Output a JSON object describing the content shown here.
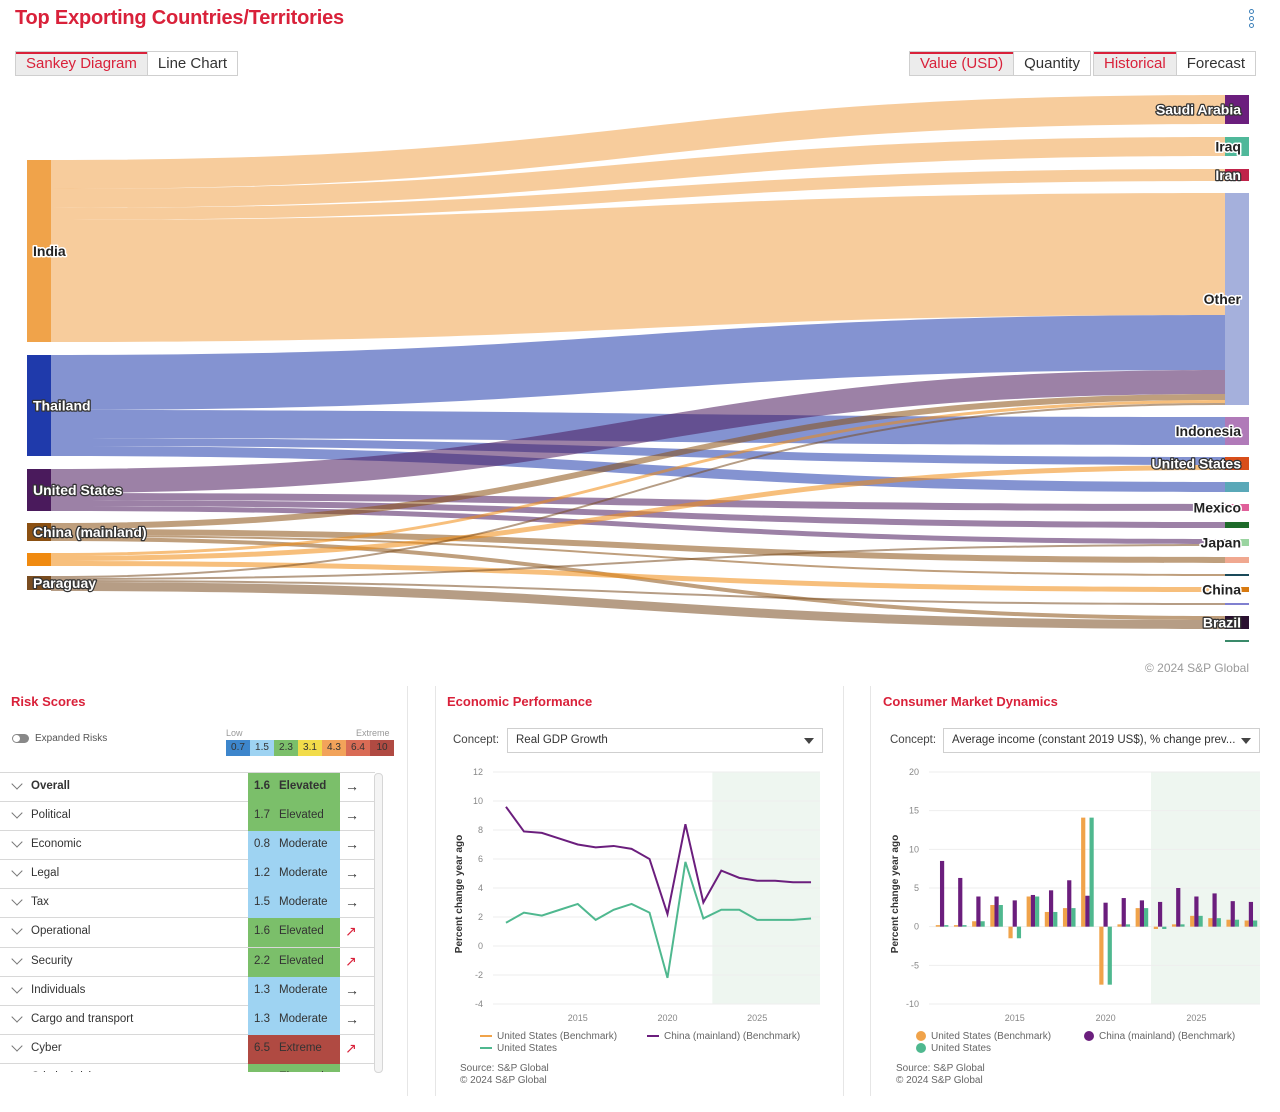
{
  "header": {
    "title": "Top Exporting Countries/Territories",
    "view_toggle": [
      {
        "label": "Sankey Diagram",
        "active": true
      },
      {
        "label": "Line Chart",
        "active": false
      }
    ],
    "measure_toggle": [
      {
        "label": "Value (USD)",
        "active": true
      },
      {
        "label": "Quantity",
        "active": false
      }
    ],
    "time_toggle": [
      {
        "label": "Historical",
        "active": true
      },
      {
        "label": "Forecast",
        "active": false
      }
    ],
    "menu_icon": "kebab-vertical-icon"
  },
  "sankey": {
    "copyright": "© 2024 S&P Global",
    "sources": [
      {
        "name": "India",
        "color": "#f0a34a",
        "value": 182,
        "label_invert": false
      },
      {
        "name": "Thailand",
        "color": "#1f3aab",
        "value": 101,
        "label_invert": true
      },
      {
        "name": "United States",
        "color": "#4a1a5c",
        "value": 42,
        "label_invert": true
      },
      {
        "name": "China (mainland)",
        "color": "#8b5012",
        "value": 18,
        "label_invert": true
      },
      {
        "name": "",
        "color": "#f08a10",
        "value": 13,
        "label_invert": false
      },
      {
        "name": "Paraguay",
        "color": "#7a4d20",
        "value": 14,
        "label_invert": true
      }
    ],
    "targets": [
      {
        "name": "Saudi Arabia",
        "color": "#6b1e7d",
        "value": 29,
        "label_invert": true
      },
      {
        "name": "Iraq",
        "color": "#4fb89a",
        "value": 19,
        "label_invert": false
      },
      {
        "name": "Iran",
        "color": "#c0234a",
        "value": 12,
        "label_invert": true
      },
      {
        "name": "Other",
        "color": "#a5b0dc",
        "value": 212,
        "label_invert": false
      },
      {
        "name": "Indonesia",
        "color": "#b07ab8",
        "value": 28,
        "label_invert": false
      },
      {
        "name": "United States",
        "color": "#d84e1a",
        "value": 13,
        "label_invert": true
      },
      {
        "name": "",
        "color": "#5aa8b8",
        "value": 10,
        "label_invert": false
      },
      {
        "name": "Mexico",
        "color": "#e0609a",
        "value": 7,
        "label_invert": false
      },
      {
        "name": "",
        "color": "#1e6b2a",
        "value": 6,
        "label_invert": false
      },
      {
        "name": "Japan",
        "color": "#9ad4a0",
        "value": 7,
        "label_invert": false
      },
      {
        "name": "",
        "color": "#f0a890",
        "value": 6,
        "label_invert": false
      },
      {
        "name": "",
        "color": "#1a4a5a",
        "value": 2,
        "label_invert": false
      },
      {
        "name": "China",
        "color": "#d87a10",
        "value": 5,
        "label_invert": false
      },
      {
        "name": "",
        "color": "#8080d0",
        "value": 2,
        "label_invert": false
      },
      {
        "name": "Brazil",
        "color": "#2a1030",
        "value": 13,
        "label_invert": true
      },
      {
        "name": "",
        "color": "#3a8a6a",
        "value": 2,
        "label_invert": false
      }
    ],
    "links": [
      {
        "source": 0,
        "target": 0,
        "value": 29
      },
      {
        "source": 0,
        "target": 1,
        "value": 19
      },
      {
        "source": 0,
        "target": 2,
        "value": 12
      },
      {
        "source": 0,
        "target": 3,
        "value": 122
      },
      {
        "source": 1,
        "target": 3,
        "value": 55
      },
      {
        "source": 1,
        "target": 4,
        "value": 28
      },
      {
        "source": 1,
        "target": 5,
        "value": 8
      },
      {
        "source": 1,
        "target": 6,
        "value": 10
      },
      {
        "source": 2,
        "target": 3,
        "value": 24
      },
      {
        "source": 2,
        "target": 7,
        "value": 7
      },
      {
        "source": 2,
        "target": 8,
        "value": 6
      },
      {
        "source": 2,
        "target": 9,
        "value": 5
      },
      {
        "source": 3,
        "target": 3,
        "value": 6
      },
      {
        "source": 3,
        "target": 10,
        "value": 6
      },
      {
        "source": 3,
        "target": 11,
        "value": 2
      },
      {
        "source": 3,
        "target": 14,
        "value": 4
      },
      {
        "source": 4,
        "target": 3,
        "value": 3
      },
      {
        "source": 4,
        "target": 5,
        "value": 5
      },
      {
        "source": 4,
        "target": 12,
        "value": 5
      },
      {
        "source": 5,
        "target": 3,
        "value": 2
      },
      {
        "source": 5,
        "target": 9,
        "value": 2
      },
      {
        "source": 5,
        "target": 13,
        "value": 2
      },
      {
        "source": 5,
        "target": 14,
        "value": 9
      },
      {
        "source": 4,
        "target": 15,
        "value": 0
      }
    ]
  },
  "risk": {
    "title": "Risk Scores",
    "toggle_label": "Expanded Risks",
    "scale_low": "Low",
    "scale_high": "Extreme",
    "scale": [
      {
        "value": "0.7",
        "color": "#3d86cc"
      },
      {
        "value": "1.5",
        "color": "#9ed3f2"
      },
      {
        "value": "2.3",
        "color": "#7bbf6a"
      },
      {
        "value": "3.1",
        "color": "#f2dc4a"
      },
      {
        "value": "4.3",
        "color": "#f2a35a"
      },
      {
        "value": "6.4",
        "color": "#d96b55"
      },
      {
        "value": "10",
        "color": "#b04a42"
      }
    ],
    "rows": [
      {
        "label": "Overall",
        "score": "1.6",
        "level": "Elevated",
        "color": "#7bbf6a",
        "trend": "→",
        "trend_up": false,
        "bold": true
      },
      {
        "label": "Political",
        "score": "1.7",
        "level": "Elevated",
        "color": "#7bbf6a",
        "trend": "→",
        "trend_up": false,
        "bold": false
      },
      {
        "label": "Economic",
        "score": "0.8",
        "level": "Moderate",
        "color": "#9ed3f2",
        "trend": "→",
        "trend_up": false,
        "bold": false
      },
      {
        "label": "Legal",
        "score": "1.2",
        "level": "Moderate",
        "color": "#9ed3f2",
        "trend": "→",
        "trend_up": false,
        "bold": false
      },
      {
        "label": "Tax",
        "score": "1.5",
        "level": "Moderate",
        "color": "#9ed3f2",
        "trend": "→",
        "trend_up": false,
        "bold": false
      },
      {
        "label": "Operational",
        "score": "1.6",
        "level": "Elevated",
        "color": "#7bbf6a",
        "trend": "↗",
        "trend_up": true,
        "bold": false
      },
      {
        "label": "Security",
        "score": "2.2",
        "level": "Elevated",
        "color": "#7bbf6a",
        "trend": "↗",
        "trend_up": true,
        "bold": false
      },
      {
        "label": "Individuals",
        "score": "1.3",
        "level": "Moderate",
        "color": "#9ed3f2",
        "trend": "→",
        "trend_up": false,
        "bold": false
      },
      {
        "label": "Cargo and transport",
        "score": "1.3",
        "level": "Moderate",
        "color": "#9ed3f2",
        "trend": "→",
        "trend_up": false,
        "bold": false
      },
      {
        "label": "Cyber",
        "score": "6.5",
        "level": "Extreme",
        "color": "#b04a42",
        "trend": "↗",
        "trend_up": true,
        "bold": false
      },
      {
        "label": "Criminal risk",
        "score": "",
        "level": "Elevated",
        "color": "#7bbf6a",
        "trend": "",
        "trend_up": false,
        "bold": false
      }
    ]
  },
  "economic": {
    "title": "Economic Performance",
    "concept_label": "Concept:",
    "concept_value": "Real GDP Growth",
    "source": "Source: S&P Global",
    "copyright": "© 2024 S&P Global"
  },
  "consumer": {
    "title": "Consumer Market Dynamics",
    "concept_label": "Concept:",
    "concept_value": "Average income (constant 2019 US$), % change prev...",
    "source": "Source: S&P Global",
    "copyright": "© 2024 S&P Global"
  },
  "chart_data": [
    {
      "type": "line",
      "title": "Economic Performance — Real GDP Growth",
      "ylabel": "Percent change year ago",
      "xlabel": "",
      "ylim": [
        -4,
        12
      ],
      "yticks": [
        -4,
        -2,
        0,
        2,
        4,
        6,
        8,
        10,
        12
      ],
      "xticks": [
        2015,
        2020,
        2025
      ],
      "x": [
        2011,
        2012,
        2013,
        2014,
        2015,
        2016,
        2017,
        2018,
        2019,
        2020,
        2021,
        2022,
        2023,
        2024,
        2025,
        2026,
        2027,
        2028
      ],
      "forecast_from": 2023,
      "series": [
        {
          "name": "United States (Benchmark)",
          "color": "#f0a34a",
          "values": []
        },
        {
          "name": "China (mainland) (Benchmark)",
          "color": "#6b1e7d",
          "values": [
            9.6,
            7.9,
            7.8,
            7.4,
            7.0,
            6.8,
            6.9,
            6.7,
            6.0,
            2.2,
            8.4,
            3.0,
            5.2,
            4.7,
            4.5,
            4.5,
            4.4,
            4.4
          ]
        },
        {
          "name": "United States",
          "color": "#4fb88f",
          "values": [
            1.6,
            2.3,
            2.1,
            2.5,
            2.9,
            1.8,
            2.5,
            2.9,
            2.3,
            -2.2,
            5.8,
            1.9,
            2.5,
            2.5,
            1.8,
            1.8,
            1.8,
            1.9
          ]
        }
      ],
      "legend": "bottom",
      "grid": true
    },
    {
      "type": "bar",
      "title": "Consumer Market Dynamics — Average income (constant 2019 US$), % change prev...",
      "ylabel": "Percent change year ago",
      "xlabel": "",
      "ylim": [
        -10,
        20
      ],
      "yticks": [
        -10,
        -5,
        0,
        5,
        10,
        15,
        20
      ],
      "xticks": [
        2015,
        2020,
        2025
      ],
      "categories": [
        2011,
        2012,
        2013,
        2014,
        2015,
        2016,
        2017,
        2018,
        2019,
        2020,
        2021,
        2022,
        2023,
        2024,
        2025,
        2026,
        2027,
        2028
      ],
      "forecast_from": 2023,
      "series": [
        {
          "name": "United States (Benchmark)",
          "color": "#f0a34a",
          "values": [
            0.2,
            0.2,
            0.7,
            2.8,
            -1.5,
            3.9,
            1.9,
            2.4,
            14.1,
            -7.5,
            0.3,
            2.4,
            -0.3,
            0.3,
            1.4,
            1.1,
            0.9,
            0.8
          ]
        },
        {
          "name": "China (mainland) (Benchmark)",
          "color": "#6b1e7d",
          "values": [
            8.5,
            6.3,
            3.9,
            3.9,
            3.4,
            4.1,
            4.7,
            6.0,
            4.0,
            3.1,
            3.7,
            3.4,
            3.2,
            5.0,
            3.9,
            4.3,
            3.3,
            3.2
          ]
        },
        {
          "name": "United States",
          "color": "#4fb88f",
          "values": [
            0.2,
            0.2,
            0.7,
            2.8,
            -1.5,
            3.9,
            1.9,
            2.4,
            14.1,
            -7.5,
            0.3,
            2.4,
            -0.3,
            0.3,
            1.4,
            1.1,
            0.9,
            0.8
          ]
        }
      ],
      "legend": "bottom",
      "grid": true
    }
  ]
}
